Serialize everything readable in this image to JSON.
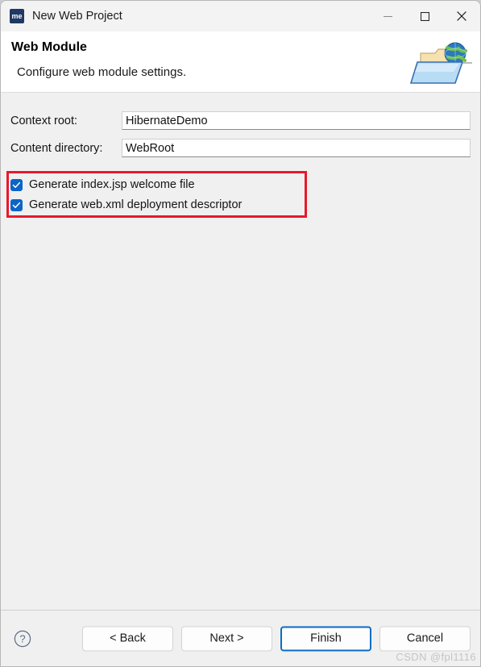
{
  "window": {
    "app_icon_label": "me",
    "title": "New Web Project",
    "controls": {
      "minimize": "minimize-icon",
      "maximize": "maximize-icon",
      "close": "close-icon"
    }
  },
  "header": {
    "title": "Web Module",
    "subtitle": "Configure web module settings.",
    "icon": "web-folder-globe-icon"
  },
  "form": {
    "fields": [
      {
        "label": "Context root:",
        "value": "HibernateDemo",
        "placeholder": ""
      },
      {
        "label": "Content directory:",
        "value": "WebRoot",
        "placeholder": ""
      }
    ],
    "checkboxes": [
      {
        "label": "Generate index.jsp welcome file",
        "checked": true
      },
      {
        "label": "Generate web.xml deployment descriptor",
        "checked": true
      }
    ],
    "annotation": {
      "type": "highlight-rectangle",
      "color": "#e8192c"
    }
  },
  "footer": {
    "help_icon": "help-circle-icon",
    "buttons": [
      {
        "label": "< Back",
        "default": false
      },
      {
        "label": "Next >",
        "default": false
      },
      {
        "label": "Finish",
        "default": true
      },
      {
        "label": "Cancel",
        "default": false
      }
    ]
  },
  "watermark": {
    "text": "CSDN @fpl1116"
  },
  "colors": {
    "accent": "#0c65c8",
    "annotation": "#e8192c",
    "dialog_bg": "#f0f0f0",
    "titlebar_bg": "#f3f3f3"
  }
}
